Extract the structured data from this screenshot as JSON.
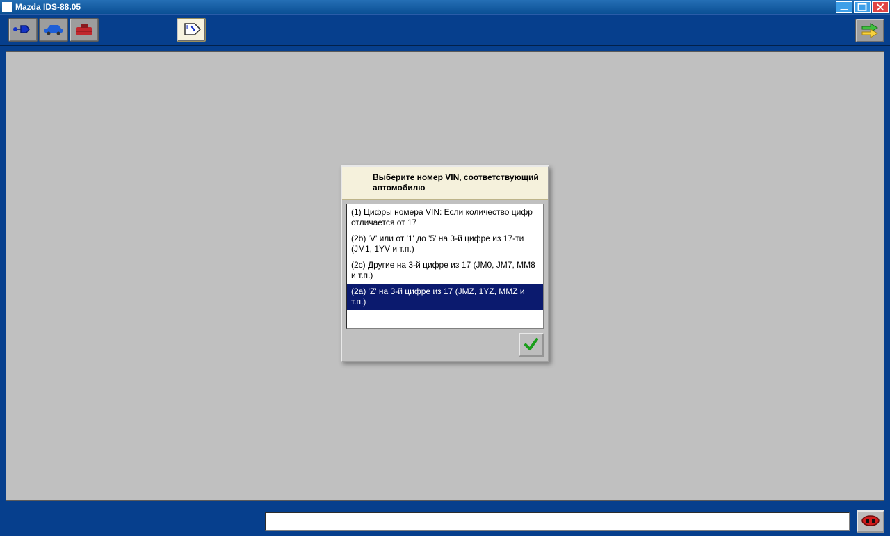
{
  "window": {
    "title": "Mazda IDS-88.05"
  },
  "toolbar": {
    "btn1": "connector-icon",
    "btn2": "vehicle-icon",
    "btn3": "toolbox-icon",
    "btn4": "info-tag-icon",
    "next": "arrows-right-icon"
  },
  "dialog": {
    "header": "Выберите номер VIN, соответствующий автомобилю",
    "items": [
      "(1) Цифры номера VIN: Если количество цифр отличается от 17",
      "(2b) 'V' или от '1' до '5' на 3-й цифре из 17-ти (JM1, 1YV и т.п.)",
      "(2c) Другие на 3-й цифре из 17 (JM0, JM7, MM8 и т.п.)",
      "(2a) 'Z' на 3-й цифре из 17 (JMZ, 1YZ, MMZ и т.п.)"
    ],
    "selected_index": 3,
    "ok": "check-icon"
  },
  "bottom": {
    "status": "",
    "error": "error-icon"
  }
}
